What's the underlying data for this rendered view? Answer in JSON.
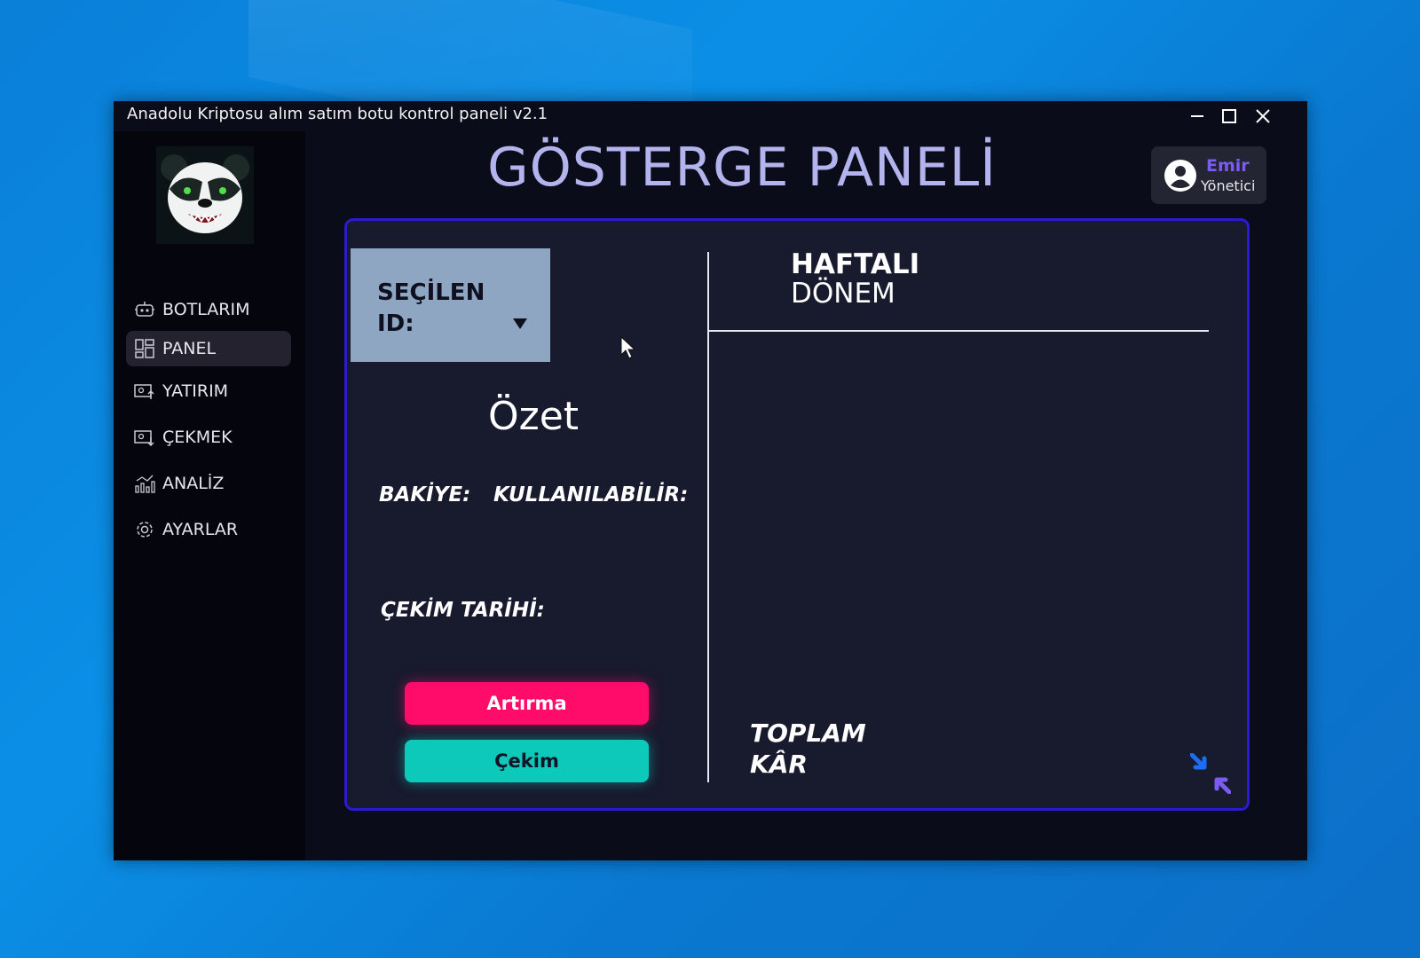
{
  "window": {
    "title": "Anadolu Kriptosu alım satım botu kontrol paneli v2.1"
  },
  "sidebar": {
    "items": [
      {
        "label": "BOTLARIM",
        "icon": "robot-icon"
      },
      {
        "label": "PANEL",
        "icon": "dashboard-grid-icon",
        "active": true
      },
      {
        "label": "YATIRIM",
        "icon": "deposit-icon"
      },
      {
        "label": "ÇEKMEK",
        "icon": "withdraw-icon"
      },
      {
        "label": "ANALİZ",
        "icon": "analytics-icon"
      },
      {
        "label": "AYARLAR",
        "icon": "gear-icon"
      }
    ]
  },
  "header": {
    "title": "GÖSTERGE PANELİ"
  },
  "user": {
    "name": "Emir",
    "role": "Yönetici"
  },
  "selector": {
    "label": "SEÇİLEN ID:"
  },
  "summary": {
    "title": "Özet",
    "balance_label": "BAKİYE:",
    "available_label": "KULLANILABİLİR:",
    "withdraw_date_label": "ÇEKİM TARİHİ:"
  },
  "buttons": {
    "increase": "Artırma",
    "withdraw": "Çekim"
  },
  "weekly": {
    "line1": "HAFTALI",
    "line2": "DÖNEM"
  },
  "total_profit": {
    "line1": "TOPLAM",
    "line2": "KÂR"
  },
  "colors": {
    "accent_title": "#b3b3ee",
    "user_name": "#7b5cf0",
    "panel_border": "#2a1ad0",
    "increase_button": "#ff0b6a",
    "withdraw_button": "#0cc9b9",
    "selector_bg": "#8ea6c2"
  }
}
